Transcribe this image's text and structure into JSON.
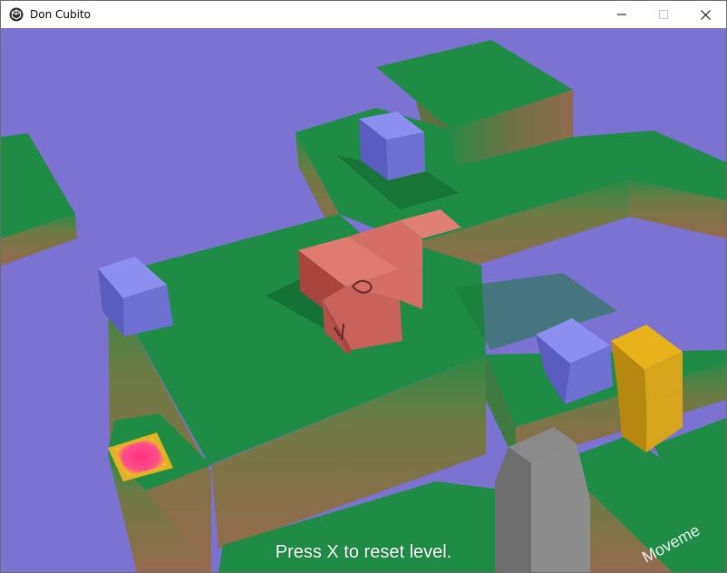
{
  "window": {
    "title": "Don Cubito",
    "icon": "game-engine-icon",
    "controls": [
      "minimize-icon",
      "maximize-icon",
      "close-icon"
    ]
  },
  "hud": {
    "reset_message": "Press X to reset level.",
    "corner_text": "Moveme"
  },
  "colors": {
    "sky": "#7b72d1",
    "grass": "#1f8f45",
    "dirt": "#8a6a45",
    "player_cube": "#c8625c",
    "blue_block": "#6d6fd0",
    "yellow_block": "#d7a51b",
    "goal_pad": "#ff3d7f",
    "wall": "#7f7f7f"
  }
}
